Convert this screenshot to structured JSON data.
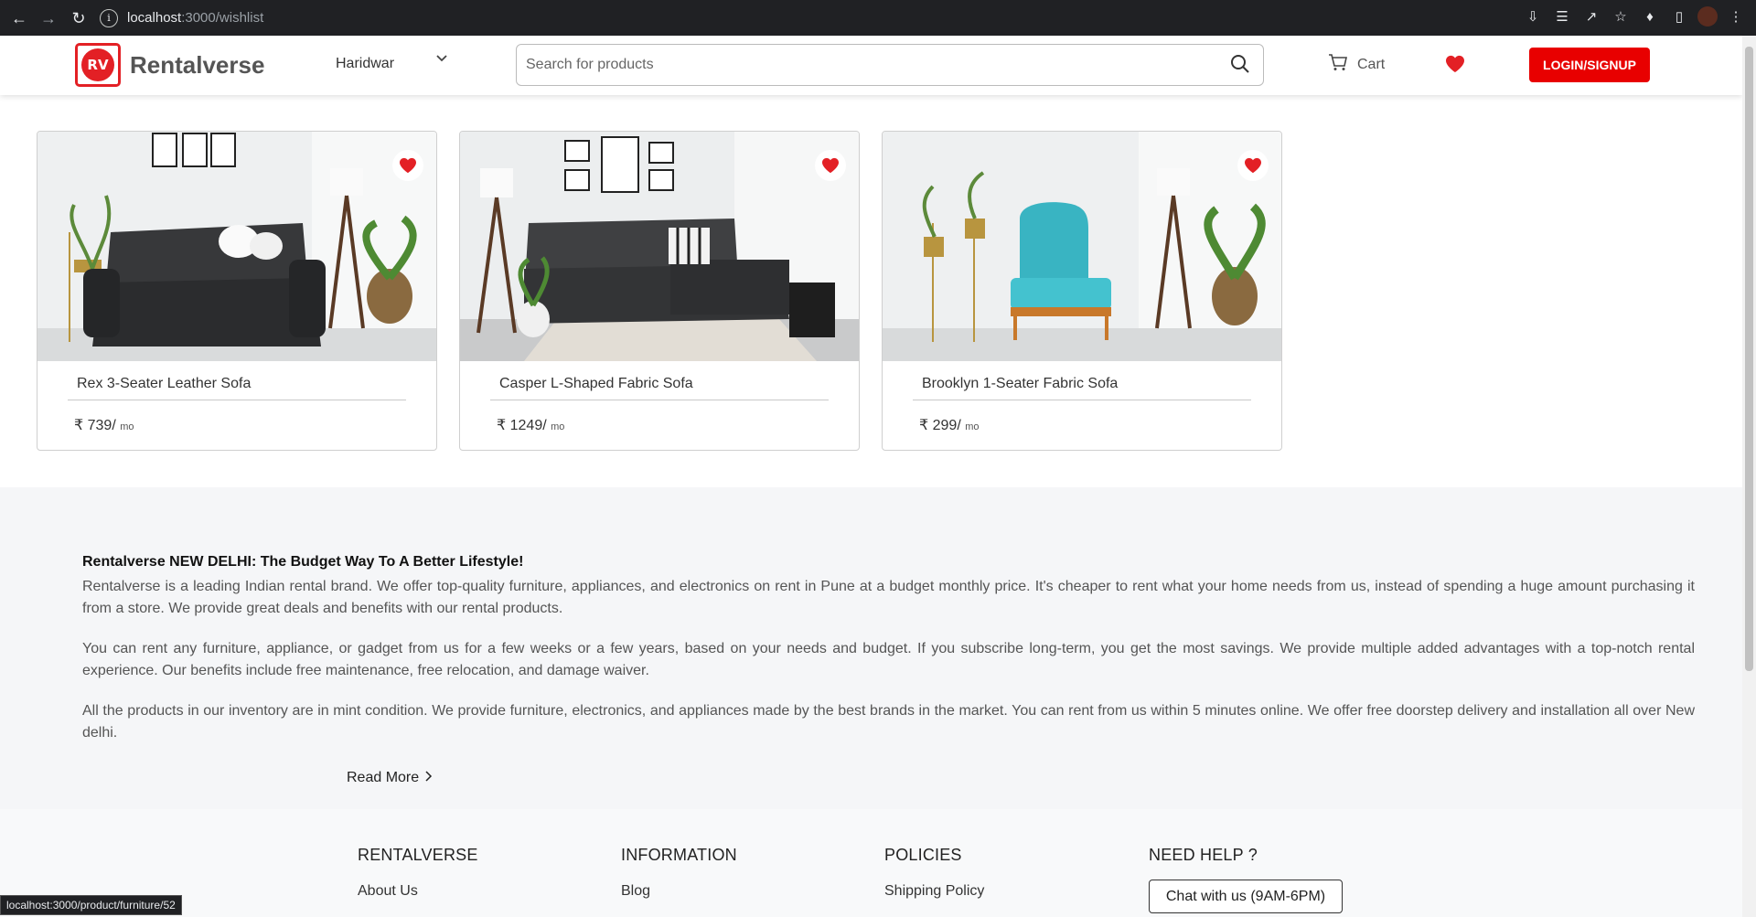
{
  "browser": {
    "url_host": "localhost",
    "url_path": ":3000/wishlist",
    "status_url": "localhost:3000/product/furniture/52"
  },
  "header": {
    "logo_text": "RV",
    "brand": "Rentalverse",
    "city": "Haridwar",
    "search_placeholder": "Search for products",
    "cart_label": "Cart",
    "login_label": "LOGIN/SIGNUP"
  },
  "products": [
    {
      "name": "Rex 3-Seater Leather Sofa",
      "price": "₹ 739/",
      "per": "mo"
    },
    {
      "name": "Casper L-Shaped Fabric Sofa",
      "price": "₹ 1249/",
      "per": "mo"
    },
    {
      "name": "Brooklyn 1-Seater Fabric Sofa",
      "price": "₹ 299/",
      "per": "mo"
    }
  ],
  "about": {
    "heading": "Rentalverse NEW DELHI: The Budget Way To A Better Lifestyle!",
    "p1": "Rentalverse is a leading Indian rental brand. We offer top-quality furniture, appliances, and electronics on rent in Pune at a budget monthly price. It's cheaper to rent what your home needs from us, instead of spending a huge amount purchasing it from a store. We provide great deals and benefits with our rental products.",
    "p2": "You can rent any furniture, appliance, or gadget from us for a few weeks or a few years, based on your needs and budget. If you subscribe long-term, you get the most savings. We provide multiple added advantages with a top-notch rental experience. Our benefits include free maintenance, free relocation, and damage waiver.",
    "p3": "All the products in our inventory are in mint condition. We provide furniture, electronics, and appliances made by the best brands in the market. You can rent from us within 5 minutes online. We offer free doorstep delivery and installation all over New delhi.",
    "read_more": "Read More"
  },
  "footer": {
    "col1_title": "RENTALVERSE",
    "col1_link": "About Us",
    "col2_title": "INFORMATION",
    "col2_link": "Blog",
    "col3_title": "POLICIES",
    "col3_link": "Shipping Policy",
    "col4_title": "NEED HELP ?",
    "chat_label": "Chat with us (9AM-6PM)"
  },
  "colors": {
    "accent": "#e80000",
    "heart": "#e32025"
  }
}
